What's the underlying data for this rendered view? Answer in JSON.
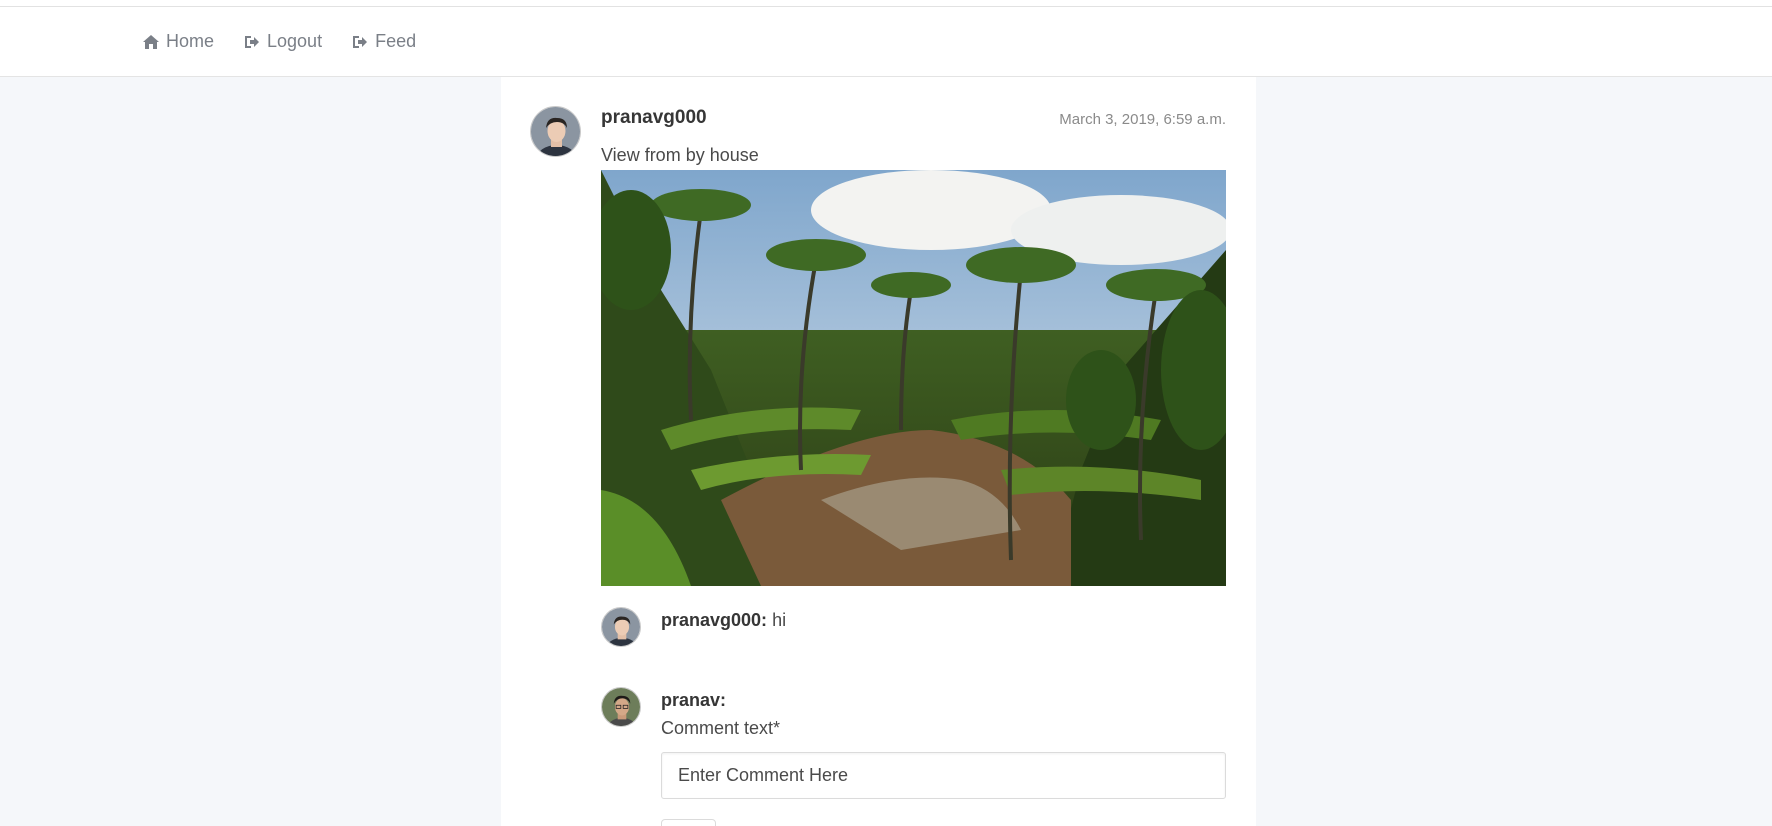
{
  "nav": {
    "items": [
      {
        "label": "Home",
        "icon": "home-icon"
      },
      {
        "label": "Logout",
        "icon": "logout-icon"
      },
      {
        "label": "Feed",
        "icon": "logout-icon"
      }
    ]
  },
  "post": {
    "username": "pranavg000",
    "timestamp": "March 3, 2019, 6:59 a.m.",
    "caption": "View from by house"
  },
  "comments": [
    {
      "username": "pranavg000:",
      "text": " hi"
    }
  ],
  "comment_form": {
    "username": "pranav:",
    "label": "Comment text*",
    "placeholder": "Enter Comment Here"
  }
}
